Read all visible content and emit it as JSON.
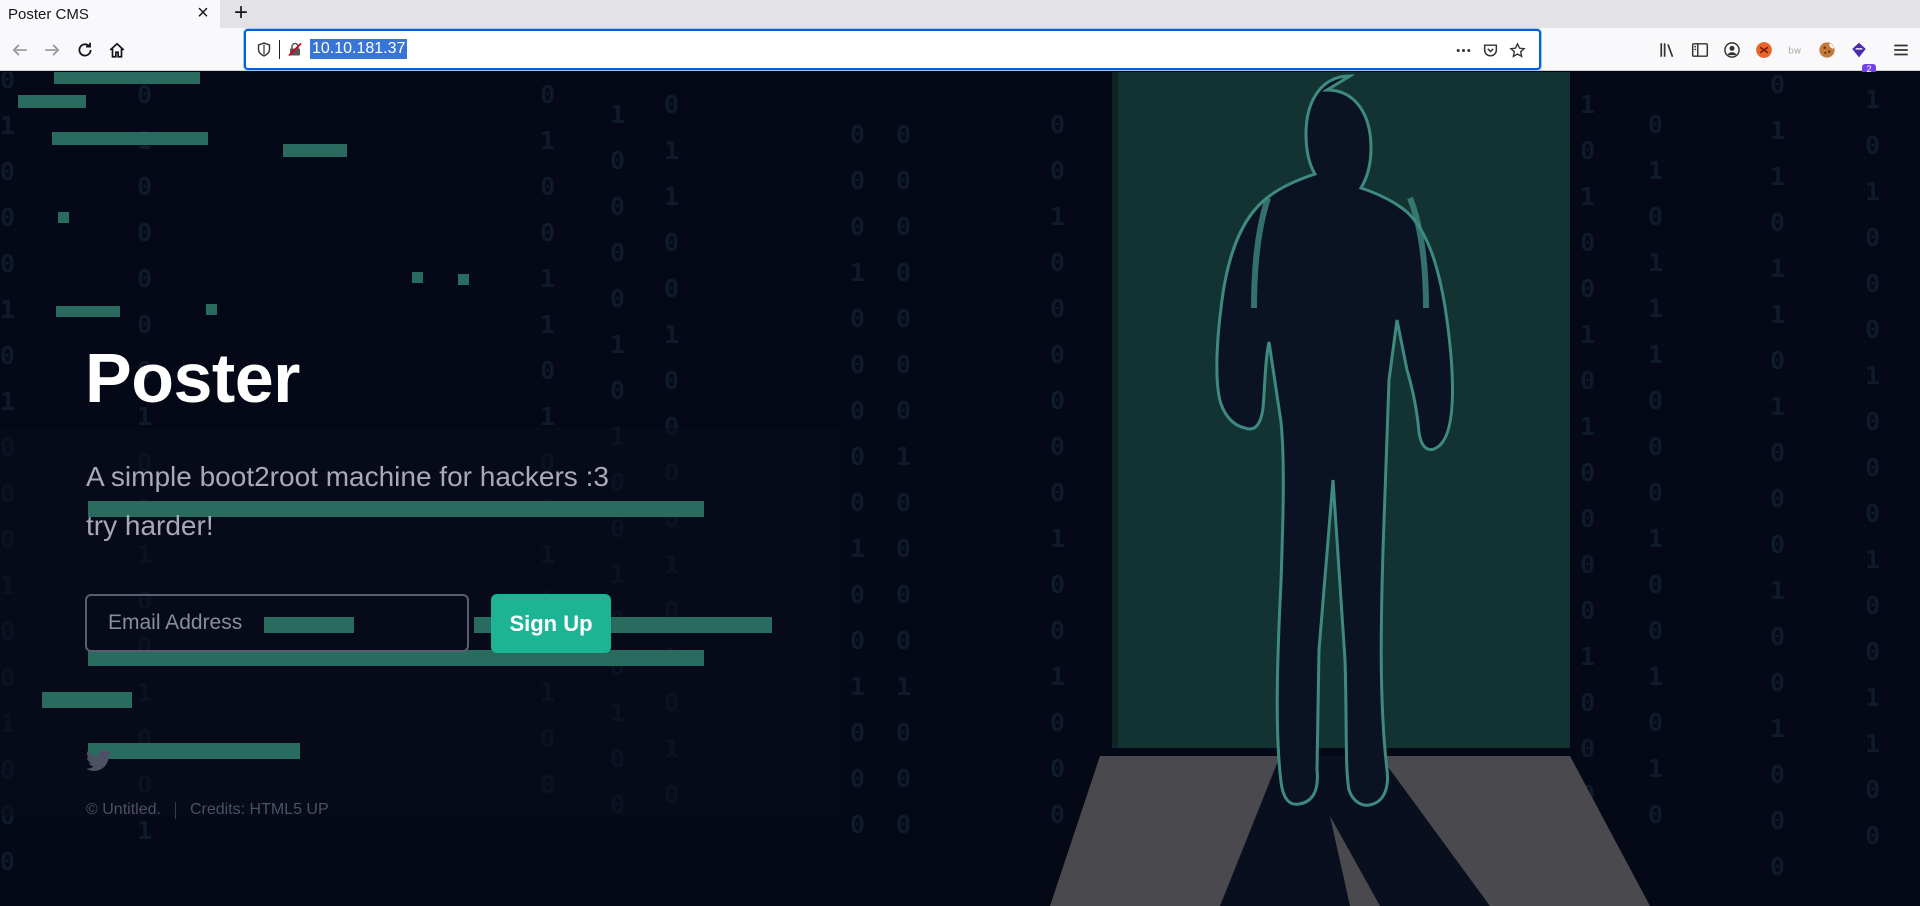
{
  "browser": {
    "tab_title": "Poster CMS",
    "tab_close": "×",
    "new_tab": "+",
    "url": "10.10.181.37",
    "extension_badge": "2"
  },
  "page": {
    "title": "Poster",
    "subtitle_line1": "A simple boot2root machine for hackers :3",
    "subtitle_line2": "try harder!",
    "email_placeholder": "Email Address",
    "signup_label": "Sign Up",
    "footer_copyright": "© Untitled.",
    "footer_credits": "Credits: HTML5 UP",
    "accent_color": "#1cb495",
    "icons": [
      "twitter-icon"
    ]
  }
}
